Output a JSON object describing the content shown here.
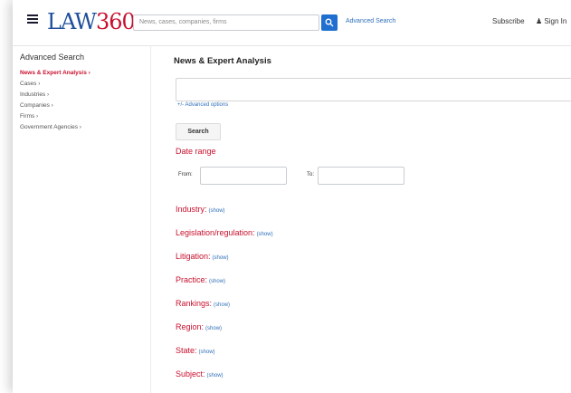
{
  "header": {
    "logo_text": "LAW",
    "logo_number": "360",
    "search_placeholder": "News, cases, companies, firms",
    "advanced_search_label": "Advanced Search",
    "subscribe_label": "Subscribe",
    "signin_label": "Sign In"
  },
  "sidebar": {
    "title": "Advanced Search",
    "items": [
      {
        "label": "News & Expert Analysis ›",
        "active": true
      },
      {
        "label": "Cases ›"
      },
      {
        "label": "Industries ›"
      },
      {
        "label": "Companies ›"
      },
      {
        "label": "Firms ›"
      },
      {
        "label": "Government Agencies ›"
      }
    ]
  },
  "main": {
    "title": "News & Expert Analysis",
    "advanced_options_label": "+/- Advanced options",
    "search_button_label": "Search",
    "date_range_label": "Date range",
    "from_label": "From:",
    "to_label": "To:",
    "facets": [
      {
        "label": "Industry:",
        "action": "(show)"
      },
      {
        "label": "Legislation/regulation:",
        "action": "(show)"
      },
      {
        "label": "Litigation:",
        "action": "(show)"
      },
      {
        "label": "Practice:",
        "action": "(show)"
      },
      {
        "label": "Rankings:",
        "action": "(show)"
      },
      {
        "label": "Region:",
        "action": "(show)"
      },
      {
        "label": "State:",
        "action": "(show)"
      },
      {
        "label": "Subject:",
        "action": "(show)"
      }
    ]
  },
  "colors": {
    "brand_blue": "#1f4f9c",
    "brand_red": "#c8102e",
    "link_blue": "#2f6fb8",
    "search_button": "#1f6fd1"
  }
}
